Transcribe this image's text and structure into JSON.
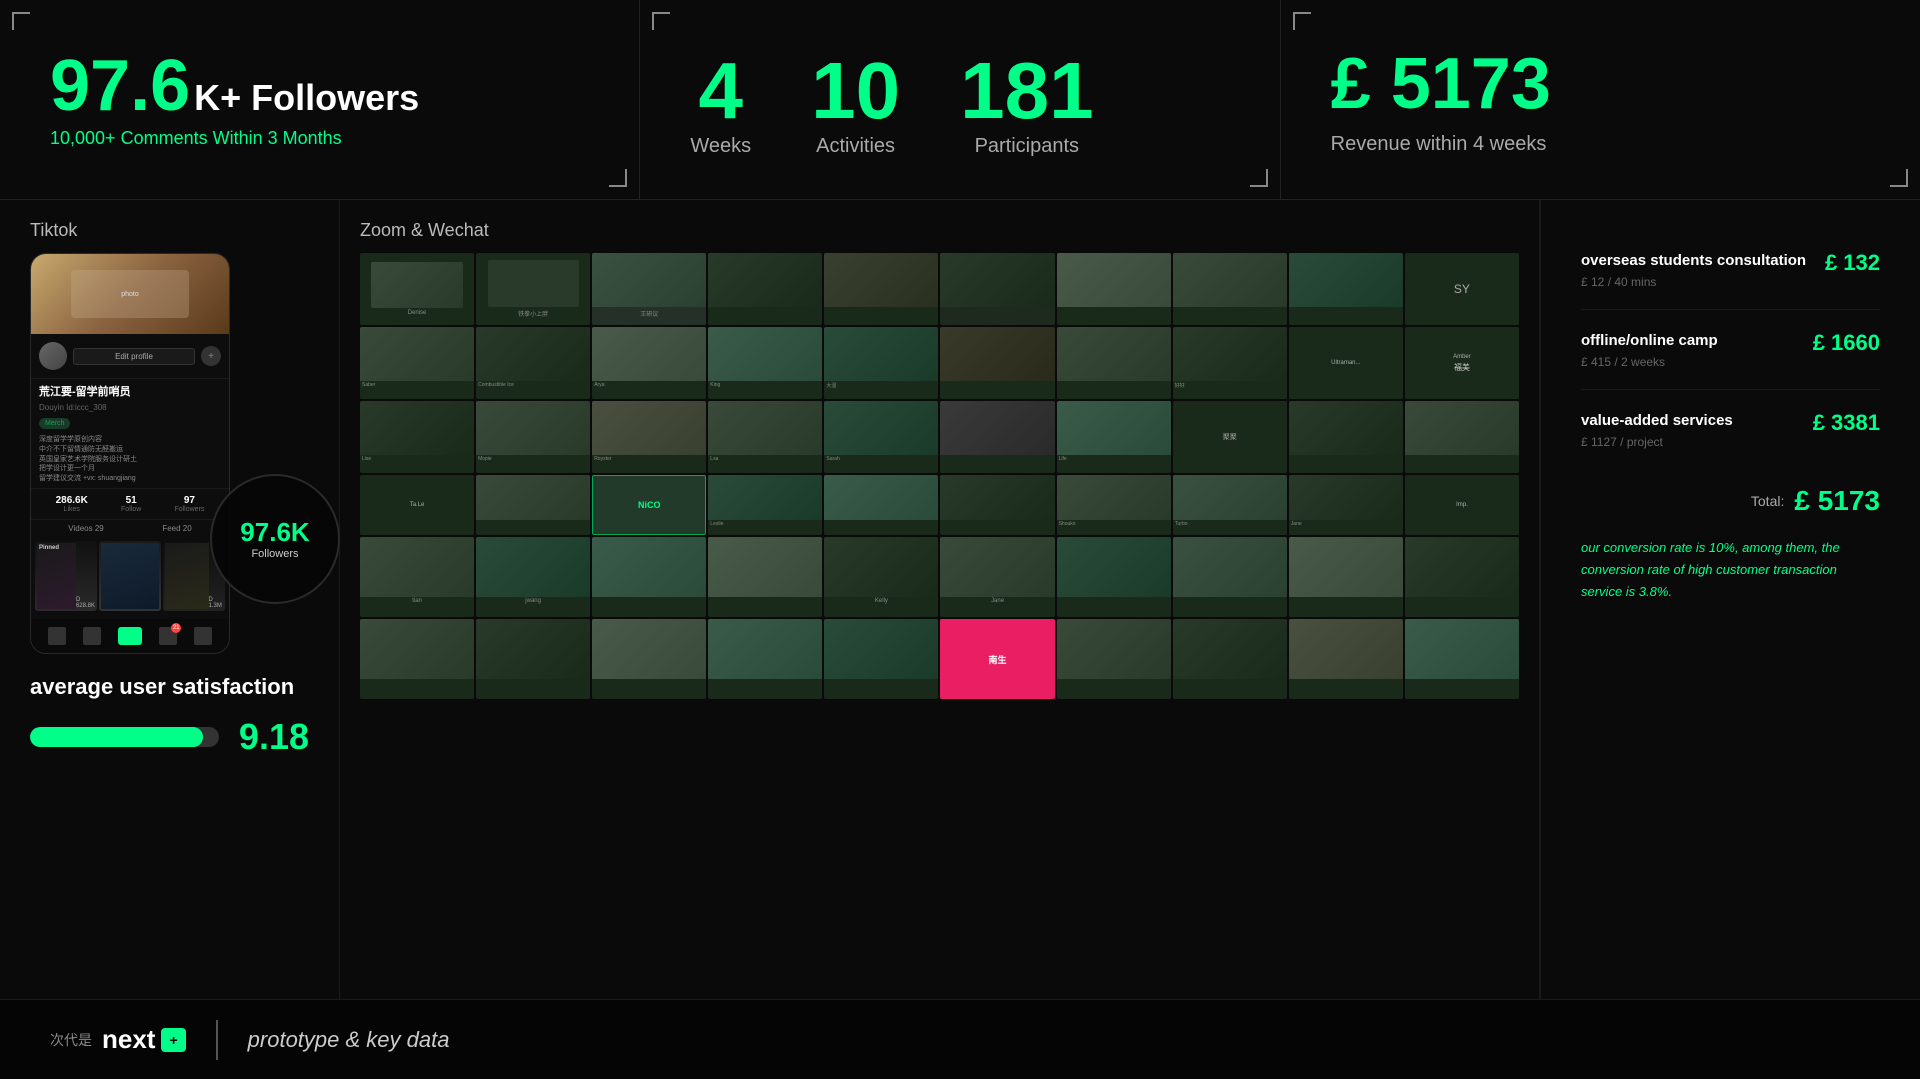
{
  "topStats": {
    "section1": {
      "number": "97.6",
      "numberSuffix": "K+ Followers",
      "subtitle": "10,000+ Comments Within 3 Months"
    },
    "section2": {
      "stats": [
        {
          "num": "4",
          "label": "Weeks"
        },
        {
          "num": "10",
          "label": "Activities"
        },
        {
          "num": "181",
          "label": "Participants"
        }
      ]
    },
    "section3": {
      "revenue": "£ 5173",
      "label": "Revenue within 4 weeks"
    }
  },
  "tiktok": {
    "title": "Tiktok",
    "profileName": "荒江要-留学前哨员",
    "profileId": "Douyin Id:iccc_308",
    "editBtn": "Edit profile",
    "tag": "Merch",
    "bio1": "深度留学学原创内容",
    "bio2": "中介不下留情通防无醛搬运",
    "bio3": "英国皇家艺术学院服务设计研土",
    "bio4": "把学设计更一个月",
    "bio5": "留学建议交流 +vx: shuangjiang",
    "statsLikes": "286.6K",
    "statsFollow": "51",
    "statsLikesLabel": "Likes",
    "statsFollowLabel": "Follow",
    "videosLabel": "Videos 29",
    "feedLabel": "Feed 20",
    "overlayNumber": "97.6K",
    "overlayLabel": "Followers",
    "videoCount1": "D 628.8K",
    "videoCount2": "D 1.3M"
  },
  "zoomWechat": {
    "title": "Zoom & Wechat"
  },
  "satisfaction": {
    "title": "average user satisfaction",
    "score": "9.18",
    "fillPercent": 91.8
  },
  "revenueItems": [
    {
      "name": "overseas students consultation",
      "detail": "£ 12 / 40 mins",
      "amount": "£ 132"
    },
    {
      "name": "offline/online camp",
      "detail": "£ 415 / 2 weeks",
      "amount": "£ 1660"
    },
    {
      "name": "value-added services",
      "detail": "£ 1127 / project",
      "amount": "£ 3381"
    }
  ],
  "totalLabel": "Total:",
  "totalAmount": "£ 5173",
  "conversionText": "our conversion rate is ",
  "conversionRate": "10%",
  "conversionMid": ", among them, the conversion rate of high customer transaction service is ",
  "conversionRate2": "3.8%",
  "conversionEnd": ".",
  "bottomLogo": "next+",
  "bottomLogoPrefix": "次代是",
  "bottomTagline": "prototype & key data",
  "zoomNames": [
    "Denise",
    "铁拳小上胖",
    "王研议",
    "",
    "",
    "",
    "",
    "",
    "",
    "SY",
    "Saber",
    "Combustible Ice",
    "Arya",
    "King",
    "大湿",
    "",
    "",
    "好好",
    "Ultraman...",
    "Amber",
    "福美",
    "Lise",
    "Mopie",
    "Royster",
    "Lsa",
    "Sarah",
    "",
    "Life",
    "聚聚",
    "",
    "",
    "Ta.Le",
    "",
    "Leslie",
    "",
    "",
    "Shouko",
    "",
    "Turbo",
    "Jane",
    "Imp.",
    "tian",
    "jwang",
    "Kelly",
    "Jane",
    "",
    "",
    "",
    "",
    "",
    ""
  ]
}
